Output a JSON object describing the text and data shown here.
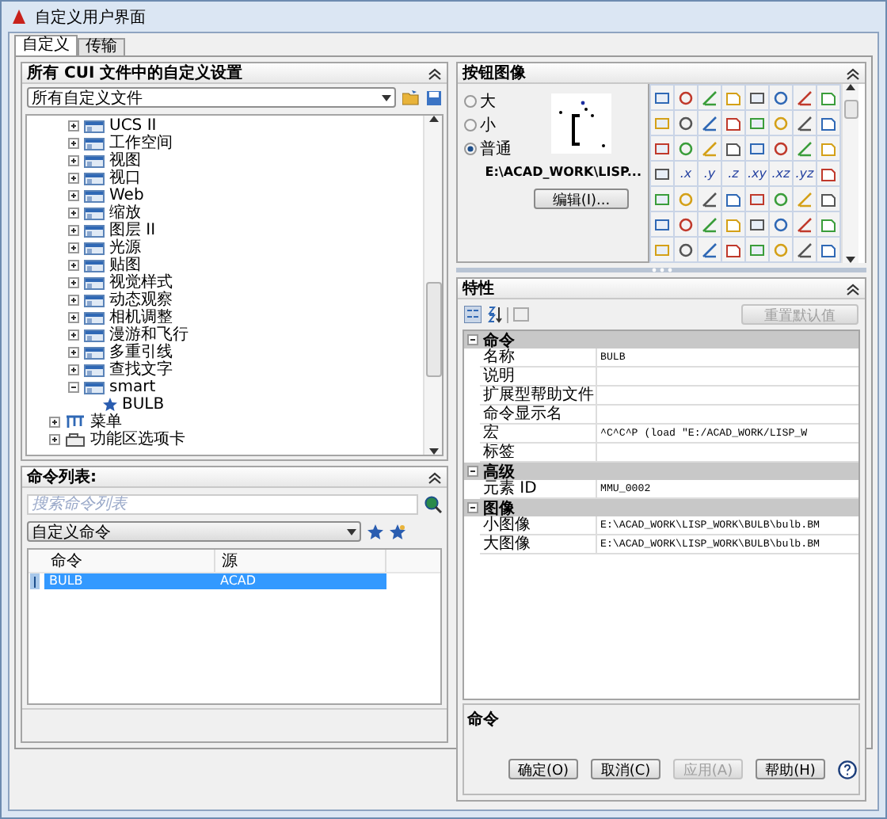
{
  "window": {
    "title": "自定义用户界面"
  },
  "tabs": [
    {
      "label": "自定义",
      "selected": true
    },
    {
      "label": "传输",
      "selected": false
    }
  ],
  "customizations": {
    "title": "所有 CUI 文件中的自定义设置",
    "file_select": "所有自定义文件",
    "tree": [
      {
        "label": "UCS II",
        "kind": "toolbar",
        "expanded": false
      },
      {
        "label": "工作空间",
        "kind": "toolbar",
        "expanded": false
      },
      {
        "label": "视图",
        "kind": "toolbar",
        "expanded": false
      },
      {
        "label": "视口",
        "kind": "toolbar",
        "expanded": false
      },
      {
        "label": "Web",
        "kind": "toolbar",
        "expanded": false
      },
      {
        "label": "缩放",
        "kind": "toolbar",
        "expanded": false
      },
      {
        "label": "图层 II",
        "kind": "toolbar",
        "expanded": false
      },
      {
        "label": "光源",
        "kind": "toolbar",
        "expanded": false
      },
      {
        "label": "贴图",
        "kind": "toolbar",
        "expanded": false
      },
      {
        "label": "视觉样式",
        "kind": "toolbar",
        "expanded": false
      },
      {
        "label": "动态观察",
        "kind": "toolbar",
        "expanded": false
      },
      {
        "label": "相机调整",
        "kind": "toolbar",
        "expanded": false
      },
      {
        "label": "漫游和飞行",
        "kind": "toolbar",
        "expanded": false
      },
      {
        "label": "多重引线",
        "kind": "toolbar",
        "expanded": false
      },
      {
        "label": "查找文字",
        "kind": "toolbar",
        "expanded": false
      },
      {
        "label": "smart",
        "kind": "toolbar",
        "expanded": true,
        "children": [
          {
            "label": "BULB",
            "kind": "command"
          }
        ]
      }
    ],
    "root_items": [
      {
        "label": "菜单",
        "kind": "menu",
        "expanded": false
      },
      {
        "label": "功能区选项卡",
        "kind": "ribbon",
        "expanded": false
      }
    ]
  },
  "command_list": {
    "title": "命令列表:",
    "search": {
      "placeholder": "搜索命令列表"
    },
    "filter": "自定义命令",
    "columns": [
      "命令",
      "源"
    ],
    "rows": [
      {
        "command": "BULB",
        "source": "ACAD",
        "selected": true
      }
    ]
  },
  "button_image": {
    "title": "按钮图像",
    "sizes": [
      {
        "label": "大",
        "selected": false
      },
      {
        "label": "小",
        "selected": false
      },
      {
        "label": "普通",
        "selected": true
      }
    ],
    "path": "E:\\ACAD_WORK\\LISP...",
    "edit": "编辑(I)...",
    "grid": [
      {
        "kind": "icon"
      },
      {
        "kind": "icon"
      },
      {
        "kind": "icon"
      },
      {
        "kind": "icon"
      },
      {
        "kind": "icon"
      },
      {
        "kind": "icon"
      },
      {
        "kind": "icon"
      },
      {
        "kind": "icon"
      },
      {
        "kind": "icon"
      },
      {
        "kind": "icon"
      },
      {
        "kind": "icon"
      },
      {
        "kind": "icon"
      },
      {
        "kind": "icon"
      },
      {
        "kind": "icon"
      },
      {
        "kind": "icon"
      },
      {
        "kind": "icon"
      },
      {
        "kind": "icon"
      },
      {
        "kind": "icon"
      },
      {
        "kind": "icon"
      },
      {
        "kind": "icon"
      },
      {
        "kind": "icon"
      },
      {
        "kind": "icon"
      },
      {
        "kind": "icon"
      },
      {
        "kind": "icon"
      },
      {
        "kind": "icon"
      },
      {
        "kind": "text",
        "label": ".x"
      },
      {
        "kind": "text",
        "label": ".y"
      },
      {
        "kind": "text",
        "label": ".z"
      },
      {
        "kind": "text",
        "label": ".xy"
      },
      {
        "kind": "text",
        "label": ".xz"
      },
      {
        "kind": "text",
        "label": ".yz"
      },
      {
        "kind": "icon"
      },
      {
        "kind": "icon"
      },
      {
        "kind": "icon"
      },
      {
        "kind": "icon"
      },
      {
        "kind": "icon"
      },
      {
        "kind": "icon"
      },
      {
        "kind": "icon"
      },
      {
        "kind": "icon"
      },
      {
        "kind": "icon"
      },
      {
        "kind": "icon"
      },
      {
        "kind": "icon"
      },
      {
        "kind": "icon"
      },
      {
        "kind": "icon"
      },
      {
        "kind": "icon"
      },
      {
        "kind": "icon"
      },
      {
        "kind": "icon"
      },
      {
        "kind": "icon"
      },
      {
        "kind": "icon"
      },
      {
        "kind": "icon"
      },
      {
        "kind": "icon"
      },
      {
        "kind": "icon"
      },
      {
        "kind": "icon"
      },
      {
        "kind": "icon"
      },
      {
        "kind": "icon"
      },
      {
        "kind": "icon"
      }
    ]
  },
  "properties": {
    "title": "特性",
    "reset": "重置默认值",
    "sections": [
      {
        "name": "命令",
        "expanded": true,
        "rows": [
          {
            "name": "名称",
            "value": "BULB"
          },
          {
            "name": "说明"
          },
          {
            "name": "扩展型帮助文件"
          },
          {
            "name": "命令显示名"
          },
          {
            "name": "宏",
            "value": "^C^C^P (load \"E:/ACAD_WORK/LISP_W"
          },
          {
            "name": "标签"
          }
        ]
      },
      {
        "name": "高级",
        "expanded": true,
        "rows": [
          {
            "name": "元素 ID",
            "value": "MMU_0002"
          }
        ]
      },
      {
        "name": "图像",
        "expanded": true,
        "rows": [
          {
            "name": "小图像",
            "value": "E:\\ACAD_WORK\\LISP_WORK\\BULB\\bulb.BM"
          },
          {
            "name": "大图像",
            "value": "E:\\ACAD_WORK\\LISP_WORK\\BULB\\bulb.BM"
          }
        ]
      }
    ],
    "description_title": "命令"
  },
  "buttons": [
    {
      "label": "确定(O)",
      "disabled": false
    },
    {
      "label": "取消(C)",
      "disabled": false
    },
    {
      "label": "应用(A)",
      "disabled": true
    },
    {
      "label": "帮助(H)",
      "disabled": false
    }
  ]
}
